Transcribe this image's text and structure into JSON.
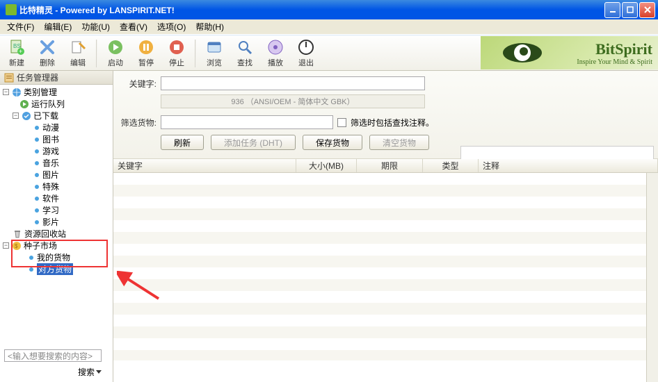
{
  "window": {
    "title": "比特精灵 - Powered by LANSPIRIT.NET!"
  },
  "menu": {
    "file": "文件(F)",
    "edit": "编辑(E)",
    "function": "功能(U)",
    "view": "查看(V)",
    "options": "选项(O)",
    "help": "帮助(H)"
  },
  "toolbar": {
    "new": "新建",
    "delete": "删除",
    "edit": "编辑",
    "start": "启动",
    "pause": "暂停",
    "stop": "停止",
    "browse": "浏览",
    "search": "查找",
    "play": "播放",
    "exit": "退出"
  },
  "branding": {
    "big": "BitSpirit",
    "sub": "Inspire Your Mind & Spirit"
  },
  "sidebar": {
    "header": "任务管理器",
    "category": "类别管理",
    "running": "运行队列",
    "downloaded": "已下载",
    "leaves": [
      "动漫",
      "图书",
      "游戏",
      "音乐",
      "图片",
      "特殊",
      "软件",
      "学习",
      "影片"
    ],
    "recycle": "资源回收站",
    "market": "种子市场",
    "mine": "我的货物",
    "other": "对方货物",
    "search_placeholder": "<输入想要搜索的内容>",
    "search_btn": "搜索"
  },
  "form": {
    "keyword_label": "关键字:",
    "encoding": "936 （ANSI/OEM - 简体中文 GBK）",
    "filter_label": "筛选货物:",
    "filter_check": "筛选时包括查找注释。",
    "refresh": "刷新",
    "add_task": "添加任务 (DHT)",
    "save": "保存货物",
    "clear": "清空货物"
  },
  "table": {
    "cols": {
      "keyword": "关键字",
      "size": "大小(MB)",
      "deadline": "期限",
      "type": "类型",
      "note": "注释"
    }
  }
}
